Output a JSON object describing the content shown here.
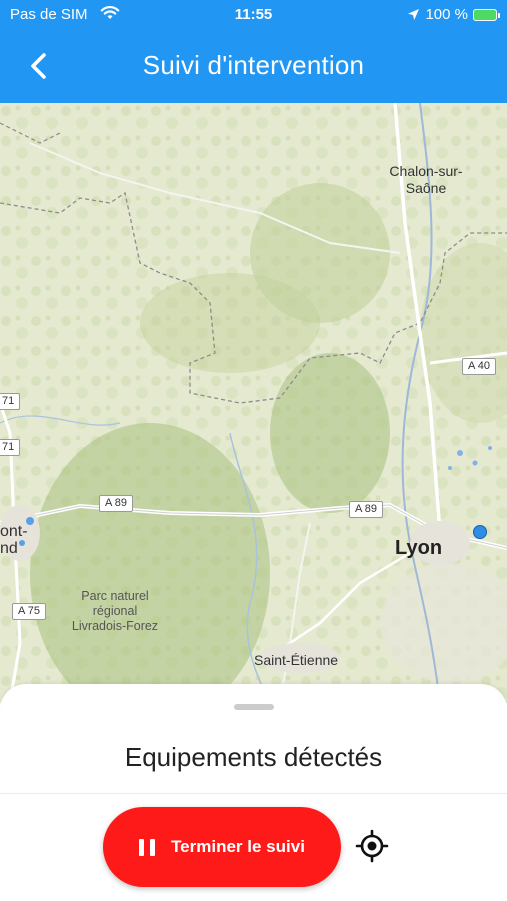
{
  "status_bar": {
    "carrier": "Pas de SIM",
    "time": "11:55",
    "battery": "100 %"
  },
  "header": {
    "title": "Suivi d'intervention",
    "back_icon": "chevron-left-icon"
  },
  "map": {
    "cities": [
      {
        "name": "Chalon-sur-\nSaône"
      },
      {
        "name": "Lyon"
      },
      {
        "name": "Saint-Étienne"
      },
      {
        "name": "ont-"
      },
      {
        "name": "nd"
      }
    ],
    "park": "Parc naturel\nrégional\nLivradois-Forez",
    "roads": [
      "A 40",
      "A 89",
      "A 89",
      "A 75",
      "71",
      "71"
    ]
  },
  "sheet": {
    "title": "Equipements détectés"
  },
  "footer": {
    "stop_button": "Terminer le suivi",
    "stop_icon": "pause-icon",
    "locate_icon": "crosshair-icon"
  },
  "colors": {
    "header": "#2196f3",
    "stop_button": "#ff1a1a",
    "map_background": "#e4e8cf"
  }
}
